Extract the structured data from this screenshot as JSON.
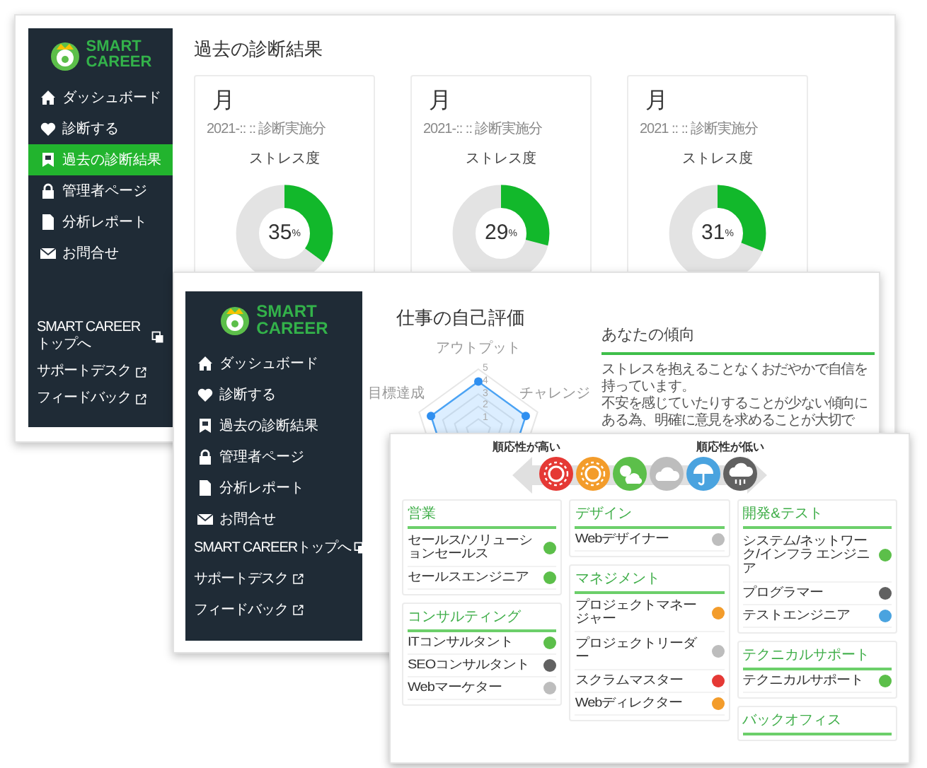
{
  "results_window": {
    "sidebar": {
      "logo": [
        "SMART",
        "CAREER"
      ],
      "items": [
        {
          "label": "ダッシュボード",
          "selected": false
        },
        {
          "label": "診断する",
          "selected": false
        },
        {
          "label": "過去の診断結果",
          "selected": true
        },
        {
          "label": "管理者ページ",
          "selected": false
        },
        {
          "label": "分析レポート",
          "selected": false
        },
        {
          "label": "お問合せ",
          "selected": false
        }
      ],
      "links": [
        {
          "label": "SMART CAREERトップへ"
        },
        {
          "label": "サポートデスク"
        },
        {
          "label": "フィードバック"
        }
      ]
    },
    "title": "過去の診断結果",
    "cards": [
      {
        "month": "月",
        "date": "2021-:: :: 診断実施分",
        "metric": "ストレス度",
        "value": "35",
        "unit": "%",
        "level": 0.35
      },
      {
        "month": "月",
        "date": "2021-:: :: 診断実施分",
        "metric": "ストレス度",
        "value": "29",
        "unit": "%",
        "level": 0.29
      },
      {
        "month": "月",
        "date": "2021 :: :: 診断実施分",
        "metric": "ストレス度",
        "value": "31",
        "unit": "%",
        "level": 0.31
      }
    ]
  },
  "evaluation_window": {
    "sidebar": {
      "logo": [
        "SMART",
        "CAREER"
      ],
      "items": [
        {
          "label": "ダッシュボード",
          "selected": false
        },
        {
          "label": "診断する",
          "selected": false
        },
        {
          "label": "過去の診断結果",
          "selected": false
        },
        {
          "label": "管理者ページ",
          "selected": false
        },
        {
          "label": "分析レポート",
          "selected": false
        },
        {
          "label": "お問合せ",
          "selected": false
        }
      ],
      "links": [
        {
          "label": "SMART CAREERトップへ"
        },
        {
          "label": "サポートデスク"
        },
        {
          "label": "フィードバック"
        }
      ]
    },
    "title": "仕事の自己評価",
    "radar": {
      "axes": [
        "アウトプット",
        "チャレンジ",
        "目標達成"
      ],
      "ticks": [
        "5",
        "4",
        "3",
        "2",
        "1"
      ]
    },
    "tendency": {
      "heading": "あなたの傾向",
      "lines": [
        "ストレスを抱えることなくおだやかで自信を持っています。",
        "不安を感じていたりすることが少ない傾向にある為、明確に意見を求めることが大切で"
      ]
    }
  },
  "jobs_window": {
    "scale": {
      "left_label": "順応性が高い",
      "right_label": "順応性が低い",
      "steps": [
        {
          "kind": "sun",
          "color": "#e53935"
        },
        {
          "kind": "sun",
          "color": "#f39c2b"
        },
        {
          "kind": "sunny-cloud",
          "color": "#5cbf4a"
        },
        {
          "kind": "cloud",
          "color": "#bdbdbd"
        },
        {
          "kind": "umbrella",
          "color": "#4aa3df"
        },
        {
          "kind": "rain",
          "color": "#616161"
        }
      ]
    },
    "columns": [
      [
        {
          "title": "営業",
          "jobs": [
            {
              "name": "セールス/ソリューションセールス",
              "color": "#5cbf4a"
            },
            {
              "name": "セールスエンジニア",
              "color": "#5cbf4a"
            }
          ]
        },
        {
          "title": "コンサルティング",
          "jobs": [
            {
              "name": "ITコンサルタント",
              "color": "#5cbf4a"
            },
            {
              "name": "SEOコンサルタント",
              "color": "#616161"
            },
            {
              "name": "Webマーケター",
              "color": "#bdbdbd"
            }
          ]
        }
      ],
      [
        {
          "title": "デザイン",
          "jobs": [
            {
              "name": "Webデザイナー",
              "color": "#bdbdbd"
            }
          ]
        },
        {
          "title": "マネジメント",
          "jobs": [
            {
              "name": "プロジェクトマネージャー",
              "color": "#f39c2b"
            },
            {
              "name": "プロジェクトリーダー",
              "color": "#bdbdbd"
            },
            {
              "name": "スクラムマスター",
              "color": "#e53935"
            },
            {
              "name": "Webディレクター",
              "color": "#f39c2b"
            }
          ]
        }
      ],
      [
        {
          "title": "開発&テスト",
          "jobs": [
            {
              "name": "システム/ネットワーク/インフラ エンジニア",
              "color": "#5cbf4a"
            },
            {
              "name": "プログラマー",
              "color": "#616161"
            },
            {
              "name": "テストエンジニア",
              "color": "#4aa3df"
            }
          ]
        },
        {
          "title": "テクニカルサポート",
          "jobs": [
            {
              "name": "テクニカルサポート",
              "color": "#5cbf4a"
            }
          ]
        },
        {
          "title": "バックオフィス"
        }
      ]
    ]
  }
}
